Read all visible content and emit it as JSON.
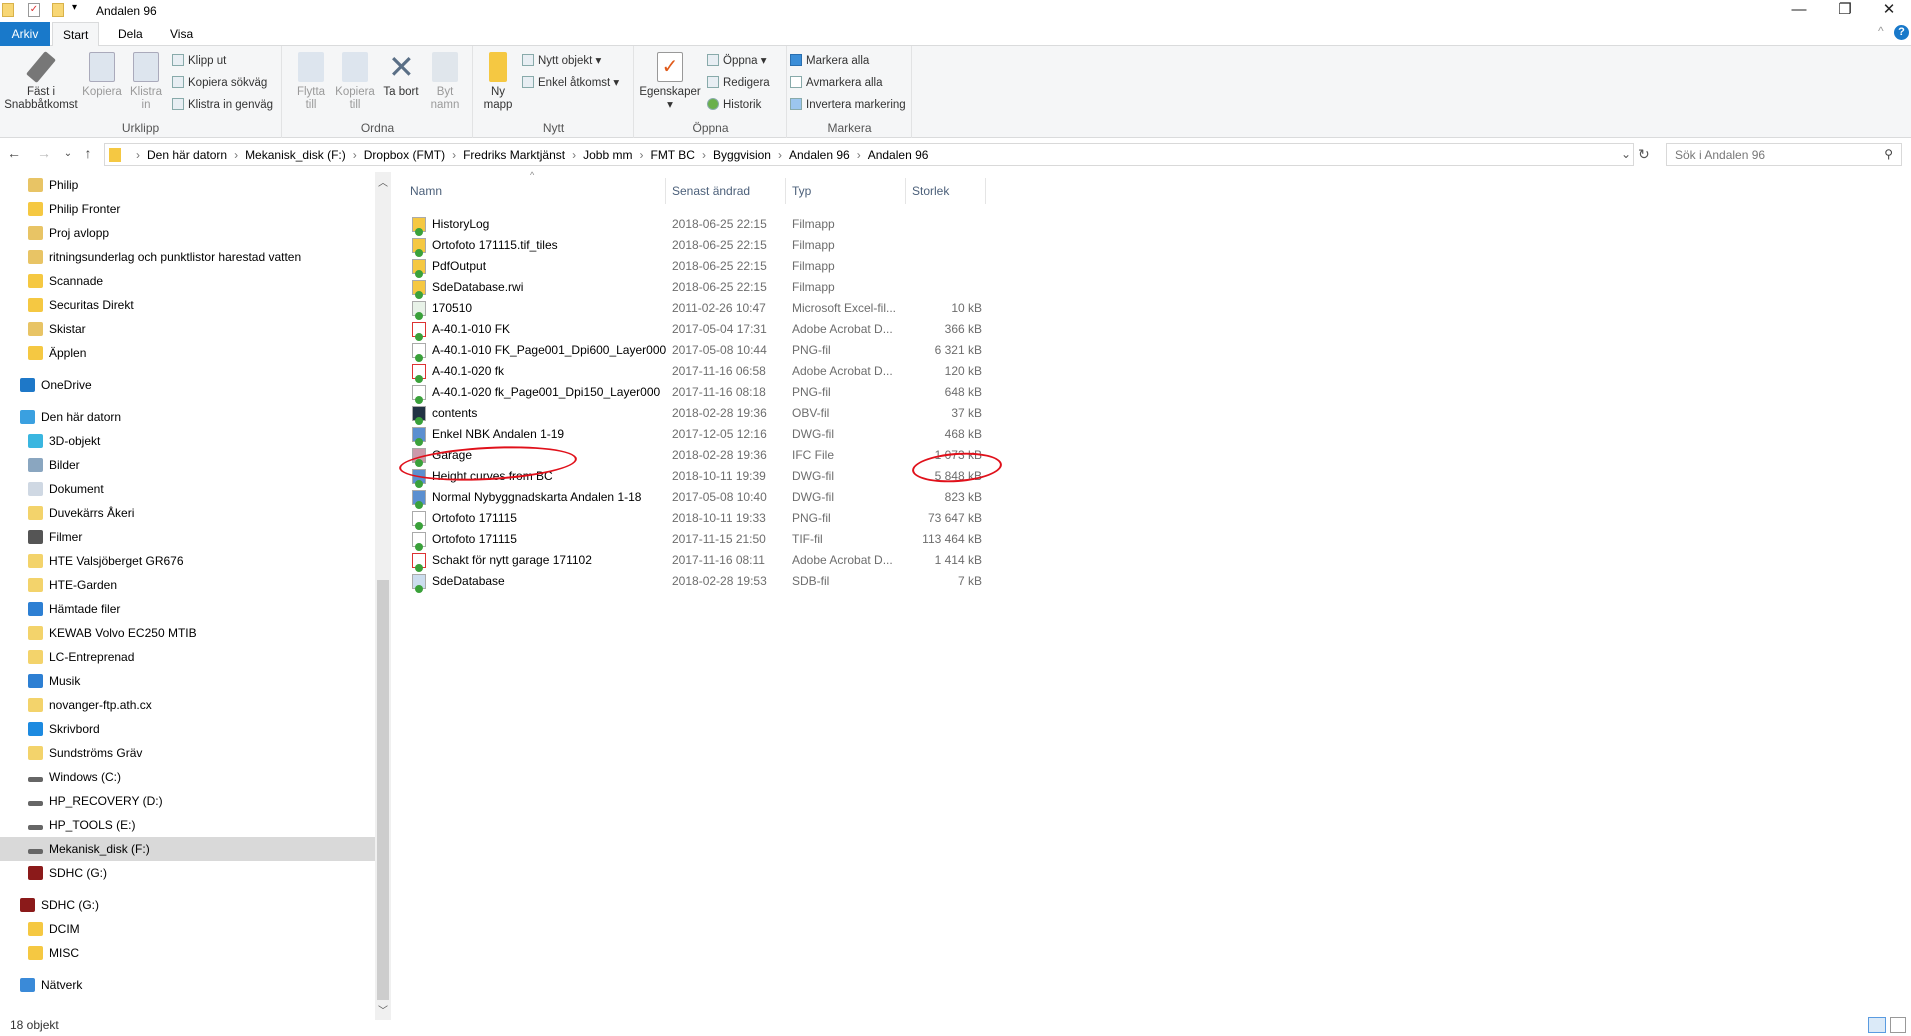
{
  "window": {
    "title": "Andalen 96",
    "minimize": "—",
    "maximize": "❐",
    "close": "✕"
  },
  "tabs": [
    {
      "label": "Arkiv"
    },
    {
      "label": "Start"
    },
    {
      "label": "Dela"
    },
    {
      "label": "Visa"
    }
  ],
  "ribbon": {
    "urklipp": {
      "label": "Urklipp",
      "pin": "Fäst i Snabbåtkomst",
      "copy": "Kopiera",
      "paste": "Klistra in",
      "cut": "Klipp ut",
      "copy_path": "Kopiera sökväg",
      "paste_shortcut": "Klistra in genväg"
    },
    "ordna": {
      "label": "Ordna",
      "move": "Flytta till",
      "copy_to": "Kopiera till",
      "delete": "Ta bort",
      "rename": "Byt namn"
    },
    "nytt": {
      "label": "Nytt",
      "new_folder": "Ny mapp",
      "new_item": "Nytt objekt",
      "easy_access": "Enkel åtkomst"
    },
    "oppna": {
      "label": "Öppna",
      "properties": "Egenskaper",
      "open": "Öppna",
      "edit": "Redigera",
      "history": "Historik"
    },
    "markera": {
      "label": "Markera",
      "select_all": "Markera alla",
      "select_none": "Avmarkera alla",
      "invert": "Invertera markering"
    }
  },
  "address": {
    "crumbs": [
      "Den här datorn",
      "Mekanisk_disk (F:)",
      "Dropbox (FMT)",
      "Fredriks Marktjänst",
      "Jobb mm",
      "FMT BC",
      "Byggvision",
      "Andalen 96",
      "Andalen 96"
    ],
    "search_placeholder": "Sök i Andalen 96"
  },
  "sidebar": [
    {
      "label": "Philip",
      "icon": "shared-folder",
      "lvl": 1
    },
    {
      "label": "Philip Fronter",
      "icon": "folder",
      "lvl": 1
    },
    {
      "label": "Proj avlopp",
      "icon": "shared-folder",
      "lvl": 1
    },
    {
      "label": "ritningsunderlag och punktlistor harestad vatten",
      "icon": "shared-folder",
      "lvl": 1
    },
    {
      "label": "Scannade",
      "icon": "folder",
      "lvl": 1
    },
    {
      "label": "Securitas Direkt",
      "icon": "folder",
      "lvl": 1
    },
    {
      "label": "Skistar",
      "icon": "shared-folder",
      "lvl": 1
    },
    {
      "label": "Äpplen",
      "icon": "folder",
      "lvl": 1
    },
    {
      "label": "OneDrive",
      "icon": "onedrive",
      "lvl": 0,
      "gap": true
    },
    {
      "label": "Den här datorn",
      "icon": "computer",
      "lvl": 0,
      "gap": true
    },
    {
      "label": "3D-objekt",
      "icon": "3d",
      "lvl": 1
    },
    {
      "label": "Bilder",
      "icon": "pictures",
      "lvl": 1
    },
    {
      "label": "Dokument",
      "icon": "documents",
      "lvl": 1
    },
    {
      "label": "Duvekärrs Åkeri",
      "icon": "network-location",
      "lvl": 1
    },
    {
      "label": "Filmer",
      "icon": "videos",
      "lvl": 1
    },
    {
      "label": "HTE Valsjöberget GR676",
      "icon": "network-location",
      "lvl": 1
    },
    {
      "label": "HTE-Garden",
      "icon": "network-location",
      "lvl": 1
    },
    {
      "label": "Hämtade filer",
      "icon": "downloads",
      "lvl": 1
    },
    {
      "label": "KEWAB Volvo EC250 MTIB",
      "icon": "network-location",
      "lvl": 1
    },
    {
      "label": "LC-Entreprenad",
      "icon": "network-location",
      "lvl": 1
    },
    {
      "label": "Musik",
      "icon": "music",
      "lvl": 1
    },
    {
      "label": "novanger-ftp.ath.cx",
      "icon": "network-location",
      "lvl": 1
    },
    {
      "label": "Skrivbord",
      "icon": "desktop",
      "lvl": 1
    },
    {
      "label": "Sundströms Gräv",
      "icon": "network-location",
      "lvl": 1
    },
    {
      "label": "Windows (C:)",
      "icon": "drive",
      "lvl": 1
    },
    {
      "label": "HP_RECOVERY (D:)",
      "icon": "drive",
      "lvl": 1
    },
    {
      "label": "HP_TOOLS (E:)",
      "icon": "drive",
      "lvl": 1
    },
    {
      "label": "Mekanisk_disk (F:)",
      "icon": "drive",
      "lvl": 1,
      "selected": true
    },
    {
      "label": "SDHC (G:)",
      "icon": "sd-card",
      "lvl": 1
    },
    {
      "label": "SDHC (G:)",
      "icon": "sd-card",
      "lvl": 0,
      "gap": true
    },
    {
      "label": "DCIM",
      "icon": "folder",
      "lvl": 1
    },
    {
      "label": "MISC",
      "icon": "folder",
      "lvl": 1
    },
    {
      "label": "Nätverk",
      "icon": "network",
      "lvl": 0,
      "gap": true
    }
  ],
  "columns": {
    "name": "Namn",
    "date": "Senast ändrad",
    "type": "Typ",
    "size": "Storlek"
  },
  "files": [
    {
      "name": "HistoryLog",
      "date": "2018-06-25 22:15",
      "type": "Filmapp",
      "size": "",
      "icon": "folder"
    },
    {
      "name": "Ortofoto 171115.tif_tiles",
      "date": "2018-06-25 22:15",
      "type": "Filmapp",
      "size": "",
      "icon": "folder"
    },
    {
      "name": "PdfOutput",
      "date": "2018-06-25 22:15",
      "type": "Filmapp",
      "size": "",
      "icon": "folder"
    },
    {
      "name": "SdeDatabase.rwi",
      "date": "2018-06-25 22:15",
      "type": "Filmapp",
      "size": "",
      "icon": "folder"
    },
    {
      "name": "170510",
      "date": "2011-02-26 10:47",
      "type": "Microsoft Excel-fil...",
      "size": "10 kB",
      "icon": "excel"
    },
    {
      "name": "A-40.1-010 FK",
      "date": "2017-05-04 17:31",
      "type": "Adobe Acrobat D...",
      "size": "366 kB",
      "icon": "pdf"
    },
    {
      "name": "A-40.1-010 FK_Page001_Dpi600_Layer000",
      "date": "2017-05-08 10:44",
      "type": "PNG-fil",
      "size": "6 321 kB",
      "icon": "file"
    },
    {
      "name": "A-40.1-020 fk",
      "date": "2017-11-16 06:58",
      "type": "Adobe Acrobat D...",
      "size": "120 kB",
      "icon": "pdf"
    },
    {
      "name": "A-40.1-020 fk_Page001_Dpi150_Layer000",
      "date": "2017-11-16 08:18",
      "type": "PNG-fil",
      "size": "648 kB",
      "icon": "file"
    },
    {
      "name": "contents",
      "date": "2018-02-28 19:36",
      "type": "OBV-fil",
      "size": "37 kB",
      "icon": "obv"
    },
    {
      "name": "Enkel NBK Andalen 1-19",
      "date": "2017-12-05 12:16",
      "type": "DWG-fil",
      "size": "468 kB",
      "icon": "dwg"
    },
    {
      "name": "Garage",
      "date": "2018-02-28 19:36",
      "type": "IFC File",
      "size": "1 073 kB",
      "icon": "ifc"
    },
    {
      "name": "Height curves from BC",
      "date": "2018-10-11 19:39",
      "type": "DWG-fil",
      "size": "5 848 kB",
      "icon": "dwg",
      "highlighted": true
    },
    {
      "name": "Normal Nybyggnadskarta Andalen 1-18",
      "date": "2017-05-08 10:40",
      "type": "DWG-fil",
      "size": "823 kB",
      "icon": "dwg"
    },
    {
      "name": "Ortofoto 171115",
      "date": "2018-10-11 19:33",
      "type": "PNG-fil",
      "size": "73 647 kB",
      "icon": "file"
    },
    {
      "name": "Ortofoto 171115",
      "date": "2017-11-15 21:50",
      "type": "TIF-fil",
      "size": "113 464 kB",
      "icon": "file"
    },
    {
      "name": "Schakt för nytt garage 171102",
      "date": "2017-11-16 08:11",
      "type": "Adobe Acrobat D...",
      "size": "1 414 kB",
      "icon": "pdf"
    },
    {
      "name": "SdeDatabase",
      "date": "2018-02-28 19:53",
      "type": "SDB-fil",
      "size": "7 kB",
      "icon": "sdb"
    }
  ],
  "status": {
    "count": "18 objekt"
  },
  "colors": {
    "accent": "#1979ca",
    "annotation": "#e0101a",
    "selected": "#d9d9d9"
  }
}
